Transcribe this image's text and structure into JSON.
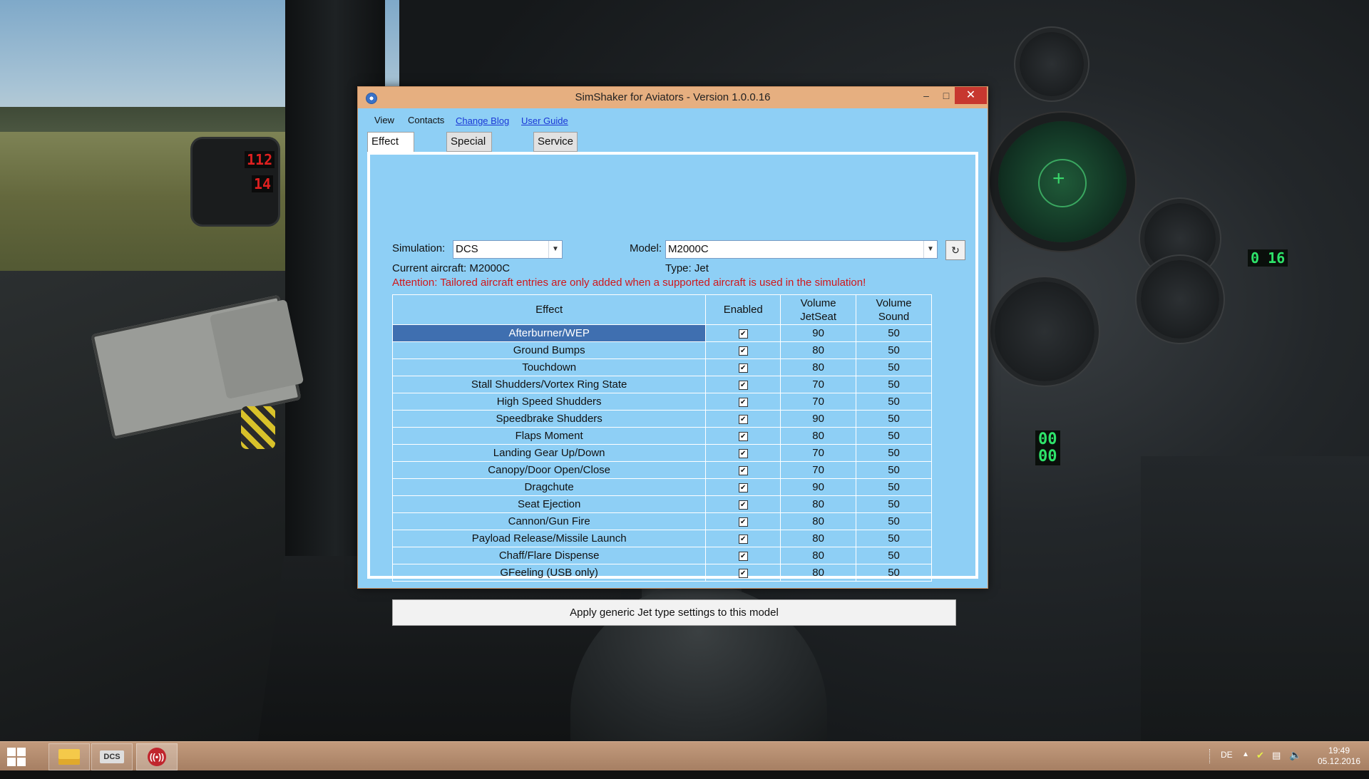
{
  "window": {
    "title": "SimShaker for Aviators  - Version 1.0.0.16",
    "minimize_icon": "minimize-icon",
    "maximize_icon": "maximize-icon",
    "close_icon": "close-icon"
  },
  "menu": {
    "items": [
      "View",
      "Contacts"
    ],
    "links": [
      "Change Blog",
      "User Guide"
    ]
  },
  "tabs": [
    {
      "label": "Effect Settings",
      "active": true
    },
    {
      "label": "Special Options",
      "active": false
    },
    {
      "label": "Service",
      "active": false
    }
  ],
  "form": {
    "simulation_label": "Simulation:",
    "simulation_value": "DCS",
    "model_label": "Model:",
    "model_value": "M2000C",
    "current_aircraft": "Current aircraft: M2000C",
    "type": "Type: Jet",
    "attention": "Attention: Tailored aircraft entries are only added when a supported aircraft is used in the simulation!",
    "refresh_icon": "refresh-icon"
  },
  "table": {
    "headers": {
      "effect": "Effect",
      "enabled": "Enabled",
      "volume_jetseat_1": "Volume",
      "volume_jetseat_2": "JetSeat",
      "volume_sound_1": "Volume",
      "volume_sound_2": "Sound"
    },
    "rows": [
      {
        "effect": "Afterburner/WEP",
        "enabled": true,
        "jetseat": "90",
        "sound": "50",
        "selected": true
      },
      {
        "effect": "Ground Bumps",
        "enabled": true,
        "jetseat": "80",
        "sound": "50"
      },
      {
        "effect": "Touchdown",
        "enabled": true,
        "jetseat": "80",
        "sound": "50"
      },
      {
        "effect": "Stall Shudders/Vortex Ring State",
        "enabled": true,
        "jetseat": "70",
        "sound": "50"
      },
      {
        "effect": "High Speed Shudders",
        "enabled": true,
        "jetseat": "70",
        "sound": "50"
      },
      {
        "effect": "Speedbrake Shudders",
        "enabled": true,
        "jetseat": "90",
        "sound": "50"
      },
      {
        "effect": "Flaps Moment",
        "enabled": true,
        "jetseat": "80",
        "sound": "50"
      },
      {
        "effect": "Landing Gear Up/Down",
        "enabled": true,
        "jetseat": "70",
        "sound": "50"
      },
      {
        "effect": "Canopy/Door Open/Close",
        "enabled": true,
        "jetseat": "70",
        "sound": "50"
      },
      {
        "effect": "Dragchute",
        "enabled": true,
        "jetseat": "90",
        "sound": "50"
      },
      {
        "effect": "Seat Ejection",
        "enabled": true,
        "jetseat": "80",
        "sound": "50"
      },
      {
        "effect": "Cannon/Gun Fire",
        "enabled": true,
        "jetseat": "80",
        "sound": "50"
      },
      {
        "effect": "Payload Release/Missile Launch",
        "enabled": true,
        "jetseat": "80",
        "sound": "50"
      },
      {
        "effect": "Chaff/Flare Dispense",
        "enabled": true,
        "jetseat": "80",
        "sound": "50"
      },
      {
        "effect": "GFeeling (USB only)",
        "enabled": true,
        "jetseat": "80",
        "sound": "50"
      }
    ]
  },
  "apply_button": "Apply generic Jet type settings to this model",
  "taskbar": {
    "apps": [
      "file-explorer-icon",
      "dcs-icon",
      "simshaker-icon"
    ],
    "dcs_text": "DCS",
    "language": "DE",
    "time": "19:49",
    "date": "05.12.2016"
  },
  "background": {
    "left_led_top": "112",
    "left_led_bottom": "14",
    "right_led": "0 16",
    "center_led_1": "00",
    "center_led_2": "00"
  },
  "colors": {
    "window_bg": "#8ecff5",
    "titlebar": "#e6af80",
    "close_button": "#c7372f",
    "selection": "#3f6fb0",
    "attention_text": "#d0161b",
    "link": "#1a37d6"
  }
}
